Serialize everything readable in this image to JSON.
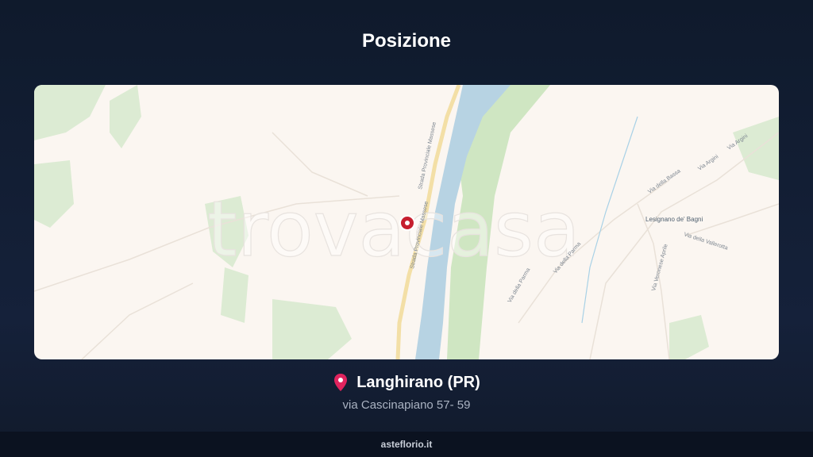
{
  "header": {
    "title": "Posizione"
  },
  "map": {
    "watermark": "trovacasa",
    "labels": {
      "road_1": "Strada Provinciale Massese",
      "road_2": "Strada Provinciale Massese",
      "town": "Lesignano de' Bagni",
      "via_bassa": "Via della Bassa",
      "via_argini_1": "Via Argini",
      "via_argini_2": "Via Argini",
      "via_parma_1": "Via della Parma",
      "via_parma_2": "Via della Parma",
      "via_vallerotta": "Via della Vallerotta",
      "via_veronese": "Via Veronese Aprile"
    }
  },
  "location": {
    "city": "Langhirano (PR)",
    "address": "via Cascinapiano 57- 59"
  },
  "footer": {
    "site": "asteflorio.it"
  }
}
